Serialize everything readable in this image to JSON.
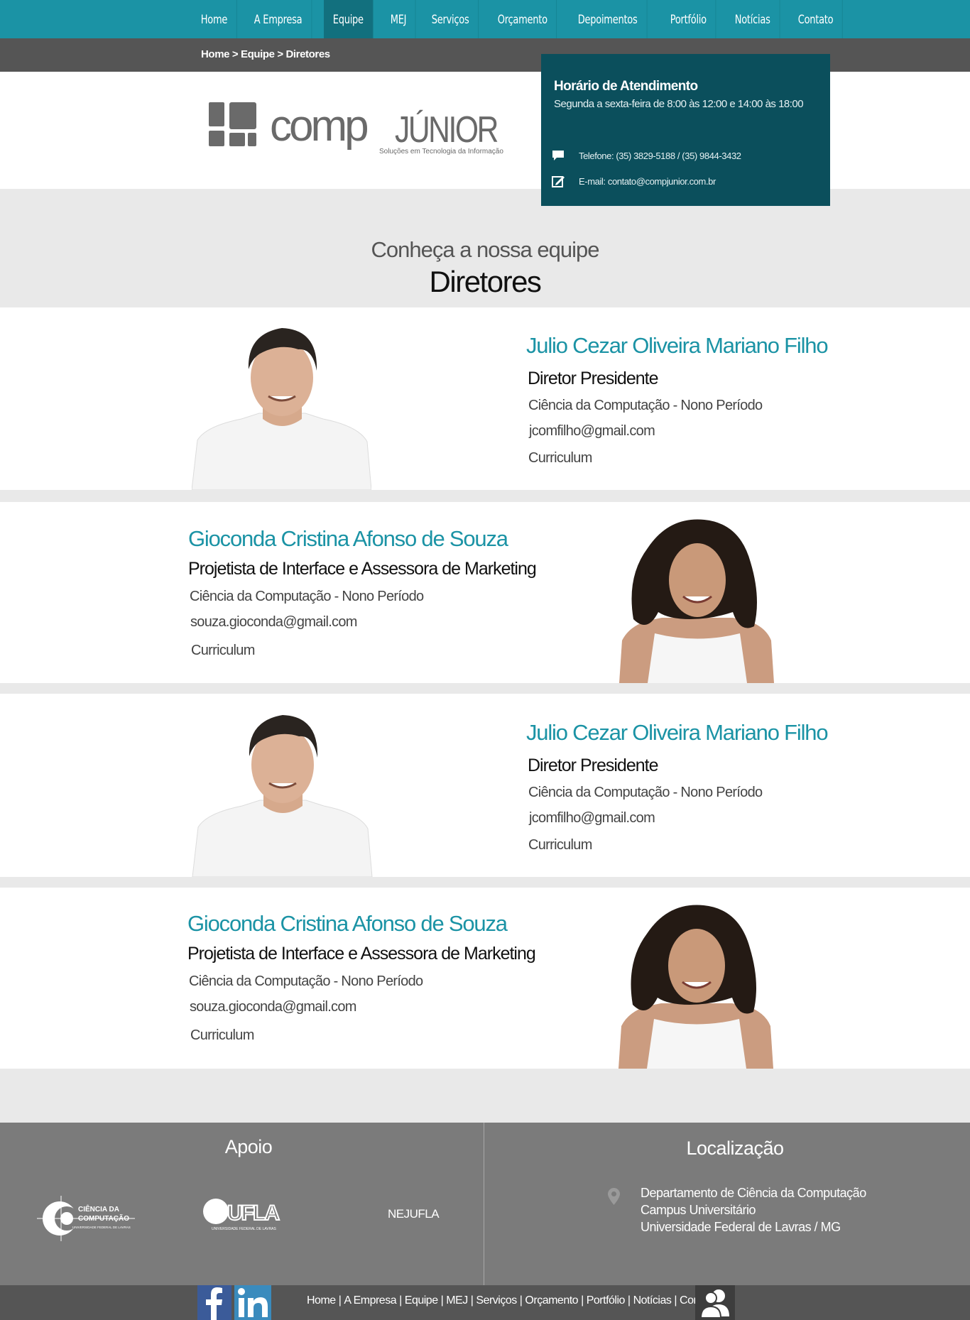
{
  "nav": {
    "items": [
      "Home",
      "A Empresa",
      "Equipe",
      "MEJ",
      "Serviços",
      "Orçamento",
      "Depoimentos",
      "Portfólio",
      "Notícias",
      "Contato"
    ],
    "active_index": 2
  },
  "breadcrumb": "Home > Equipe > Diretores",
  "logo": {
    "word_main": "comp",
    "word_accent": "JÚNIOR",
    "tagline": "Soluções em Tecnologia da Informação"
  },
  "contact_box": {
    "title": "Horário de Atendimento",
    "hours": "Segunda a sexta-feira de 8:00 às 12:00 e 14:00 às 18:00",
    "phone": "Telefone: (35) 3829-5188 / (35) 9844-3432",
    "email": "E-mail: contato@compjunior.com.br"
  },
  "section": {
    "subtitle": "Conheça a nossa equipe",
    "title": "Diretores"
  },
  "members": [
    {
      "name": "Julio Cezar Oliveira Mariano Filho",
      "role": "Diretor Presidente",
      "course": "Ciência da Computação - Nono Período",
      "email": "jcomfilho@gmail.com",
      "cv": "Curriculum"
    },
    {
      "name": "Gioconda Cristina Afonso de Souza",
      "role": "Projetista de Interface e Assessora de Marketing",
      "course": "Ciência da Computação - Nono Período",
      "email": "souza.gioconda@gmail.com",
      "cv": "Curriculum"
    },
    {
      "name": "Julio Cezar Oliveira Mariano Filho",
      "role": "Diretor Presidente",
      "course": "Ciência da Computação - Nono Período",
      "email": "jcomfilho@gmail.com",
      "cv": "Curriculum"
    },
    {
      "name": "Gioconda Cristina Afonso de Souza",
      "role": "Projetista de Interface e Assessora de Marketing",
      "course": "Ciência da Computação - Nono Período",
      "email": "souza.gioconda@gmail.com",
      "cv": "Curriculum"
    }
  ],
  "footer": {
    "apoio_title": "Apoio",
    "sponsor_cc": {
      "line1": "CIÊNCIA DA",
      "line2": "COMPUTAÇÃO",
      "line3": "UNIVERSIDADE FEDERAL DE LAVRAS"
    },
    "sponsor_ufla": {
      "mark": "UFLA",
      "sub": "UNIVERSIDADE FEDERAL DE LAVRAS"
    },
    "sponsor_text": "NEJUFLA",
    "location_title": "Localização",
    "address": [
      "Departamento de Ciência da Computação",
      "Campus Universitário",
      "Universidade Federal de Lavras / MG"
    ]
  },
  "bottom_links": [
    "Home",
    "A Empresa",
    "Equipe",
    "MEJ",
    "Serviços",
    "Orçamento",
    "Portfólio",
    "Notícias",
    "Contato"
  ],
  "colors": {
    "brand": "#1b93a5",
    "brand_dark": "#0b4f5c",
    "gray_bar": "#555555",
    "footer": "#7b7b7b"
  }
}
